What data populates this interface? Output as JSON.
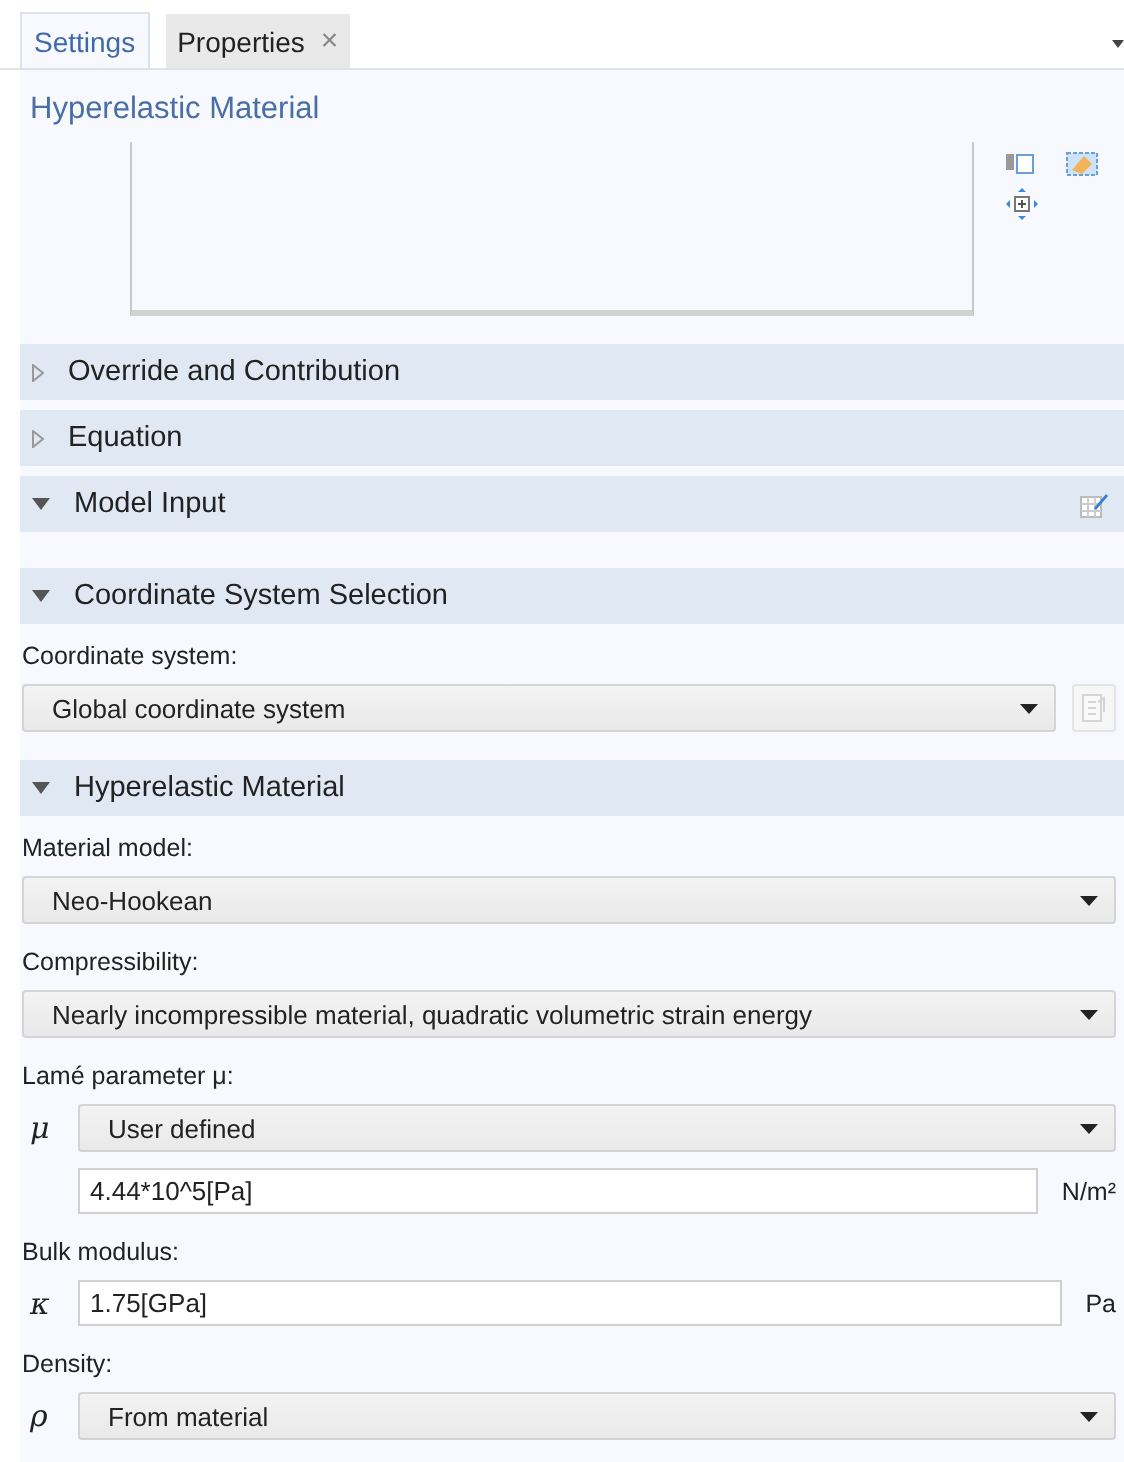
{
  "tabs": [
    {
      "label": "Settings",
      "selected": true
    },
    {
      "label": "Properties",
      "selected": false,
      "close": "×"
    }
  ],
  "title": "Hyperelastic Material",
  "sections": [
    {
      "title": "Override and Contribution",
      "expanded": false
    },
    {
      "title": "Equation",
      "expanded": false
    },
    {
      "title": "Model Input",
      "expanded": true,
      "edit_icon": true
    },
    {
      "title": "Coordinate System Selection",
      "expanded": true,
      "items": [
        {
          "kind": "label",
          "text": "Coordinate system:"
        },
        {
          "kind": "combo",
          "value": "Global coordinate system",
          "side_button": {
            "disabled": true
          }
        }
      ]
    },
    {
      "title": "Hyperelastic Material",
      "expanded": true,
      "items": [
        {
          "kind": "label",
          "text": "Material model:"
        },
        {
          "kind": "combo",
          "value": "Neo-Hookean"
        },
        {
          "kind": "label",
          "text": "Compressibility:"
        },
        {
          "kind": "combo",
          "value": "Nearly incompressible material, quadratic volumetric strain energy"
        },
        {
          "kind": "label",
          "text": "Lamé parameter μ:"
        },
        {
          "kind": "combo",
          "symbol": "μ",
          "value": "User defined"
        },
        {
          "kind": "field",
          "value": "4.44*10^5[Pa]",
          "unit": "N/m²",
          "indent": true
        },
        {
          "kind": "label",
          "text": "Bulk modulus:"
        },
        {
          "kind": "field",
          "symbol": "κ",
          "value": "1.75[GPa]",
          "unit": "Pa"
        },
        {
          "kind": "label",
          "text": "Density:"
        },
        {
          "kind": "combo",
          "symbol": "ρ",
          "value": "From material"
        }
      ]
    }
  ]
}
